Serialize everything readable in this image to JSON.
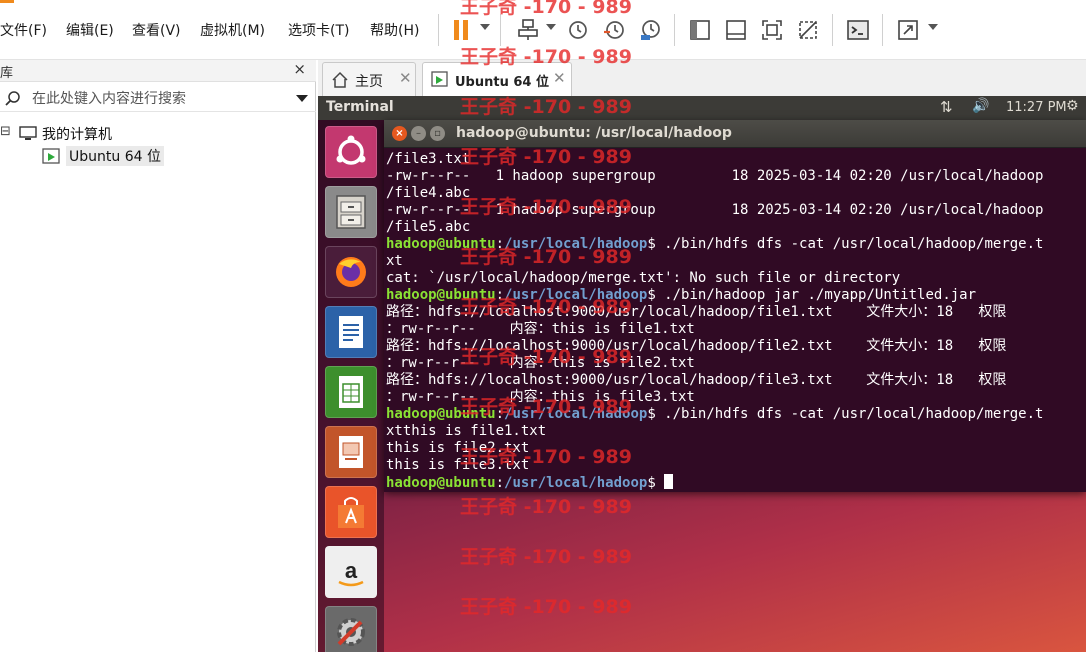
{
  "menu": [
    "文件(F)",
    "编辑(E)",
    "查看(V)",
    "虚拟机(M)",
    "选项卡(T)",
    "帮助(H)"
  ],
  "library": {
    "title": "库",
    "close": "×",
    "search_placeholder": "在此处键入内容进行搜索",
    "tree_root": "我的计算机",
    "tree_root_toggle": "⊟",
    "tree_vm": "Ubuntu 64 位"
  },
  "tabs": [
    {
      "label": "主页",
      "close": "✕"
    },
    {
      "label": "Ubuntu 64 位",
      "close": "✕"
    }
  ],
  "ubuntu_panel": {
    "app_name": "Terminal",
    "time": "11:27 PM",
    "network_icon": "⇅",
    "volume_icon": "🔊",
    "settings_icon": "⚙"
  },
  "terminal": {
    "title": "hadoop@ubuntu: /usr/local/hadoop",
    "prompt_user": "hadoop@ubuntu",
    "prompt_sep": ":",
    "prompt_path": "/usr/local/hadoop",
    "prompt_end": "$ ",
    "lines": [
      {
        "type": "out",
        "text": "/file3.txt"
      },
      {
        "type": "out",
        "text": "-rw-r--r--   1 hadoop supergroup         18 2025-03-14 02:20 /usr/local/hadoop"
      },
      {
        "type": "out",
        "text": "/file4.abc"
      },
      {
        "type": "out",
        "text": "-rw-r--r--   1 hadoop supergroup         18 2025-03-14 02:20 /usr/local/hadoop"
      },
      {
        "type": "out",
        "text": "/file5.abc"
      },
      {
        "type": "cmd",
        "text": "./bin/hdfs dfs -cat /usr/local/hadoop/merge.t"
      },
      {
        "type": "out",
        "text": "xt"
      },
      {
        "type": "out",
        "text": "cat: `/usr/local/hadoop/merge.txt': No such file or directory"
      },
      {
        "type": "cmd",
        "text": "./bin/hadoop jar ./myapp/Untitled.jar"
      },
      {
        "type": "out",
        "text": "路径：hdfs://localhost:9000/usr/local/hadoop/file1.txt    文件大小：18   权限"
      },
      {
        "type": "out",
        "text": "：rw-r--r--    内容：this is file1.txt"
      },
      {
        "type": "out",
        "text": "路径：hdfs://localhost:9000/usr/local/hadoop/file2.txt    文件大小：18   权限"
      },
      {
        "type": "out",
        "text": "：rw-r--r--    内容：this is file2.txt"
      },
      {
        "type": "out",
        "text": "路径：hdfs://localhost:9000/usr/local/hadoop/file3.txt    文件大小：18   权限"
      },
      {
        "type": "out",
        "text": "：rw-r--r--    内容：this is file3.txt"
      },
      {
        "type": "cmd",
        "text": "./bin/hdfs dfs -cat /usr/local/hadoop/merge.t"
      },
      {
        "type": "out",
        "text": "xtthis is file1.txt"
      },
      {
        "type": "out",
        "text": "this is file2.txt"
      },
      {
        "type": "out",
        "text": "this is file3.txt"
      },
      {
        "type": "prompt",
        "text": ""
      }
    ]
  },
  "watermark": "王子奇 -170 - 989",
  "colors": {
    "terminal_bg": "#300a24",
    "prompt_user": "#8ae234",
    "prompt_path": "#729fcf",
    "panel_bg": "#3c3b37",
    "pause_orange": "#f08a1c",
    "watermark_red": "#e62828"
  }
}
